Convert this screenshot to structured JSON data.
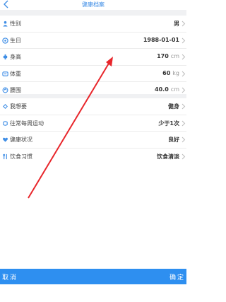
{
  "header": {
    "title": "健康档案"
  },
  "basic": [
    {
      "label": "性别",
      "value": "男",
      "unit": "",
      "icon": "person-icon"
    },
    {
      "label": "生日",
      "value": "1988-01-01",
      "unit": "",
      "icon": "birthday-icon"
    },
    {
      "label": "身高",
      "value": "170",
      "unit": "cm",
      "icon": "height-icon"
    },
    {
      "label": "体重",
      "value": "60",
      "unit": "kg",
      "icon": "weight-icon"
    },
    {
      "label": "腰围",
      "value": "40.0",
      "unit": "cm",
      "icon": "waist-icon"
    }
  ],
  "lifestyle": [
    {
      "label": "我想要",
      "value": "健身",
      "icon": "goal-icon"
    },
    {
      "label": "往常每周运动",
      "value": "少于1次",
      "icon": "exercise-icon"
    },
    {
      "label": "健康状况",
      "value": "良好",
      "icon": "health-icon"
    },
    {
      "label": "饮食习惯",
      "value": "饮食清淡",
      "icon": "diet-icon"
    }
  ],
  "footer": {
    "cancel": "取消",
    "confirm": "确定"
  },
  "colors": {
    "accent": "#2e8ff0",
    "red_arrow": "#e8262b"
  }
}
